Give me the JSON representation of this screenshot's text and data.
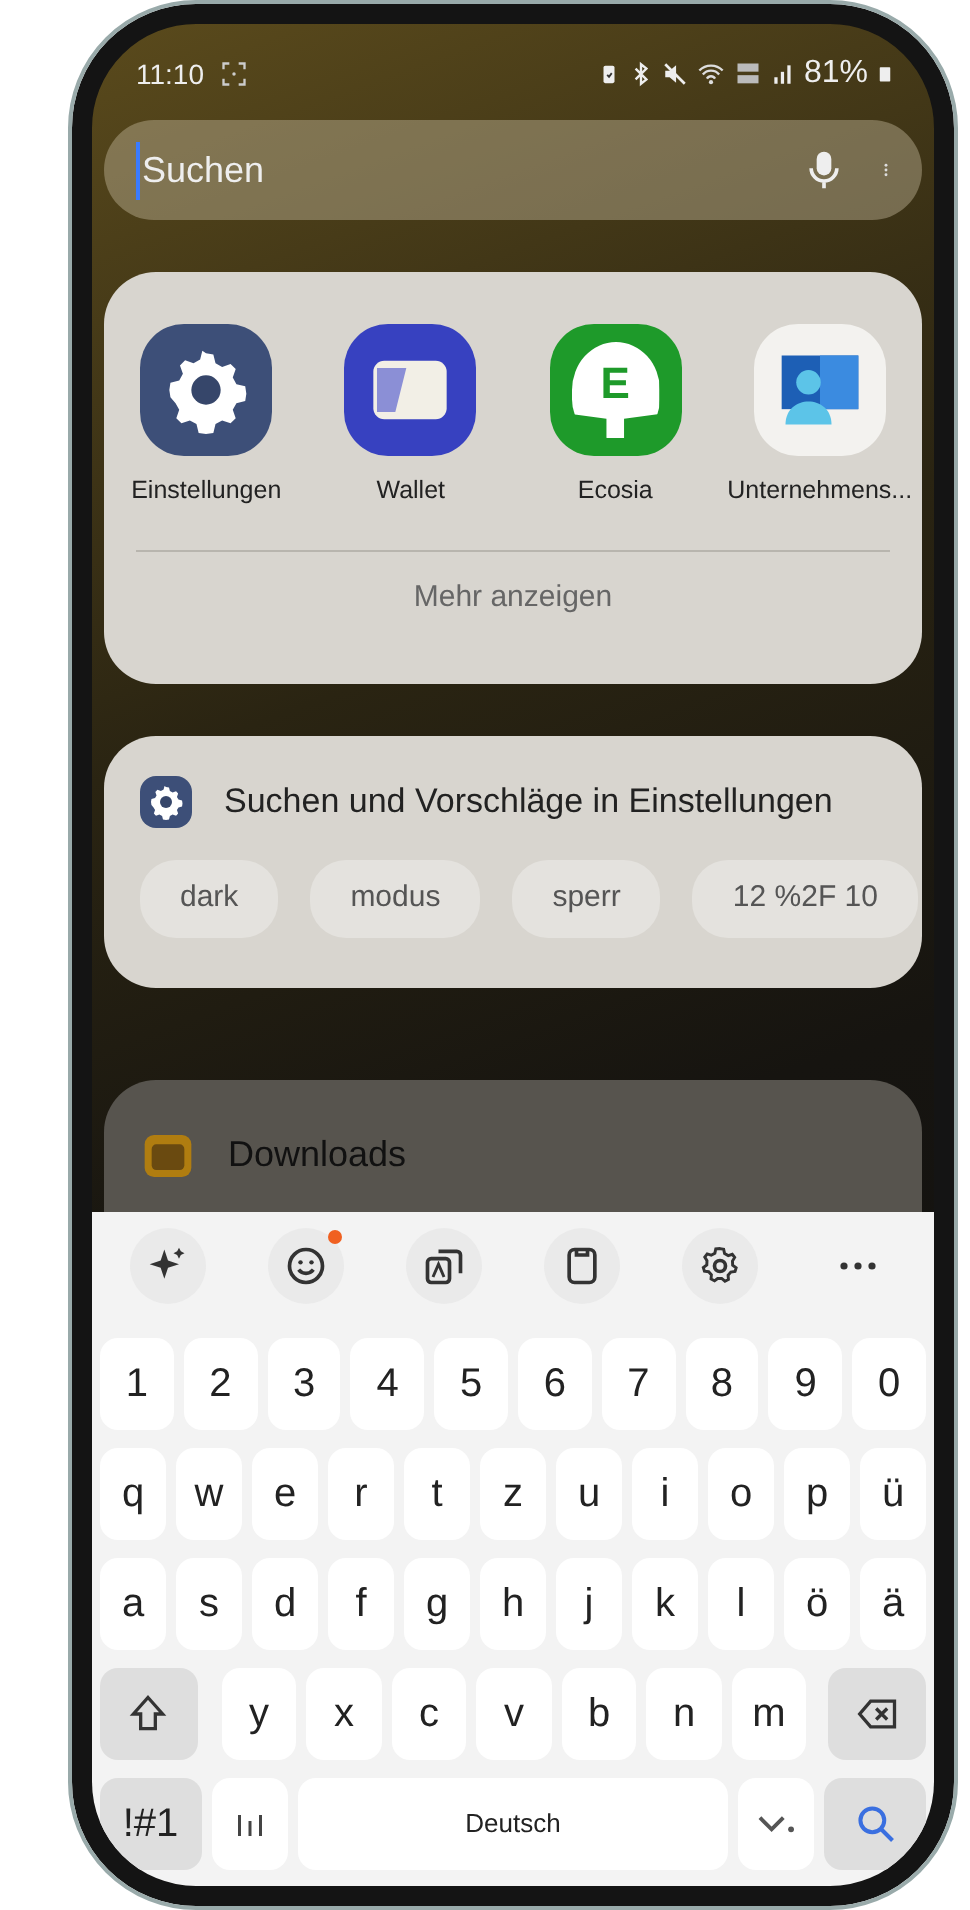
{
  "status_bar": {
    "time": "11:10",
    "battery": "81%"
  },
  "search": {
    "placeholder": "Suchen"
  },
  "apps": [
    {
      "label": "Einstellungen",
      "kind": "settings"
    },
    {
      "label": "Wallet",
      "kind": "wallet"
    },
    {
      "label": "Ecosia",
      "kind": "ecosia",
      "glyph": "E"
    },
    {
      "label": "Unternehmens...",
      "kind": "portal"
    }
  ],
  "more_button": "Mehr anzeigen",
  "settings_suggestions": {
    "title": "Suchen und Vorschläge in Einstellungen",
    "chips": [
      "dark",
      "modus",
      "sperr",
      "12 %2F 10"
    ]
  },
  "downloads": {
    "title": "Downloads"
  },
  "keyboard": {
    "toolbar": [
      {
        "kind": "sparkle",
        "notified": false
      },
      {
        "kind": "emoji",
        "notified": true
      },
      {
        "kind": "translate",
        "notified": false
      },
      {
        "kind": "clipboard",
        "notified": false
      },
      {
        "kind": "settings",
        "notified": false
      },
      {
        "kind": "more",
        "notified": false
      }
    ],
    "rows": [
      {
        "keys": [
          "1",
          "2",
          "3",
          "4",
          "5",
          "6",
          "7",
          "8",
          "9",
          "0"
        ]
      },
      {
        "keys": [
          "q",
          "w",
          "e",
          "r",
          "t",
          "z",
          "u",
          "i",
          "o",
          "p",
          "ü"
        ]
      },
      {
        "keys": [
          "a",
          "s",
          "d",
          "f",
          "g",
          "h",
          "j",
          "k",
          "l",
          "ö",
          "ä"
        ]
      },
      {
        "keys": [
          "y",
          "x",
          "c",
          "v",
          "b",
          "n",
          "m"
        ]
      }
    ],
    "symbols_key": "!#1",
    "space_key": "Deutsch"
  }
}
